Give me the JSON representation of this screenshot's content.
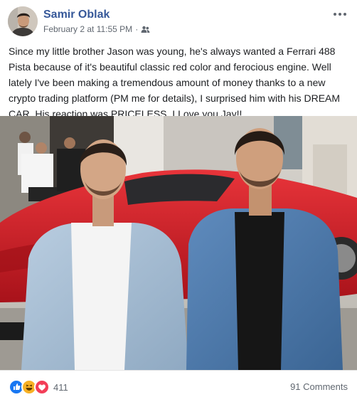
{
  "post": {
    "author": "Samir Oblak",
    "timestamp": "February 2 at 11:55 PM",
    "separator": "·",
    "audience_icon": "friends-icon",
    "body": "Since my little brother Jason was young, he's always wanted a Ferrari 488 Pista because of it's beautiful classic red color and ferocious engine. Well lately I've been making a tremendous amount of money thanks to a new crypto trading platform (PM me for details), I surprised him with his DREAM CAR. His reaction was PRICELESS. I Love you Jay!!"
  },
  "reactions": {
    "icons": [
      "like-icon",
      "haha-icon",
      "love-icon"
    ],
    "count": "411"
  },
  "comments": {
    "label": "91 Comments"
  },
  "colors": {
    "author_link": "#365899",
    "meta_gray": "#606770",
    "like_blue": "#1877f2",
    "haha_yellow": "#f7b125",
    "love_red": "#f33e58",
    "ferrari_red": "#d91a1f"
  }
}
